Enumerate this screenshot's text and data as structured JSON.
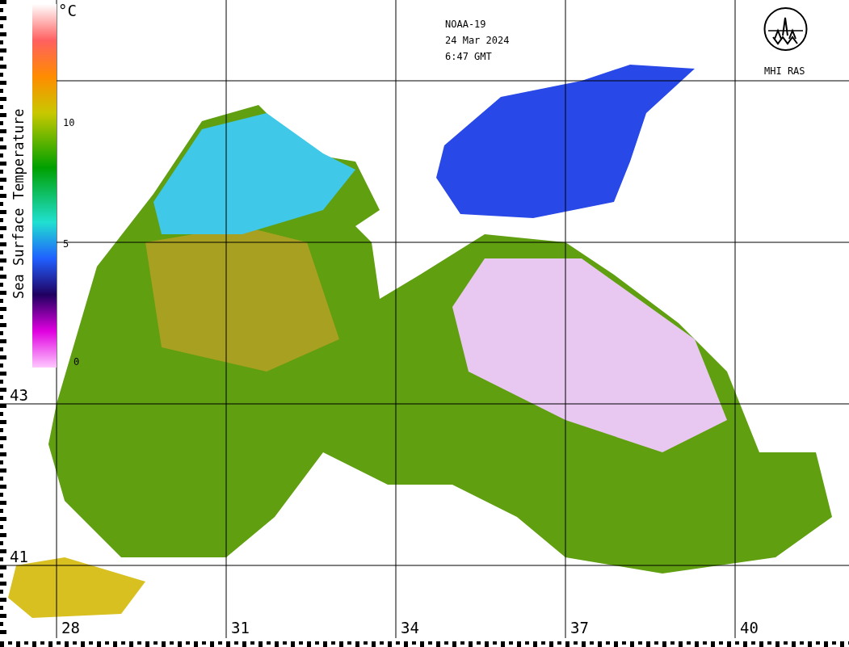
{
  "legend": {
    "unit": "°C",
    "title": "Sea Surface Temperature",
    "ticks": [
      "10",
      "5",
      "0"
    ]
  },
  "header": {
    "satellite": "NOAA-19",
    "date": "24 Mar 2024",
    "time": "6:47 GMT"
  },
  "logo": {
    "caption": "MHI RAS"
  },
  "map": {
    "latitude_labels": [
      "43",
      "41"
    ],
    "longitude_labels": [
      "28",
      "31",
      "34",
      "37",
      "40"
    ]
  }
}
